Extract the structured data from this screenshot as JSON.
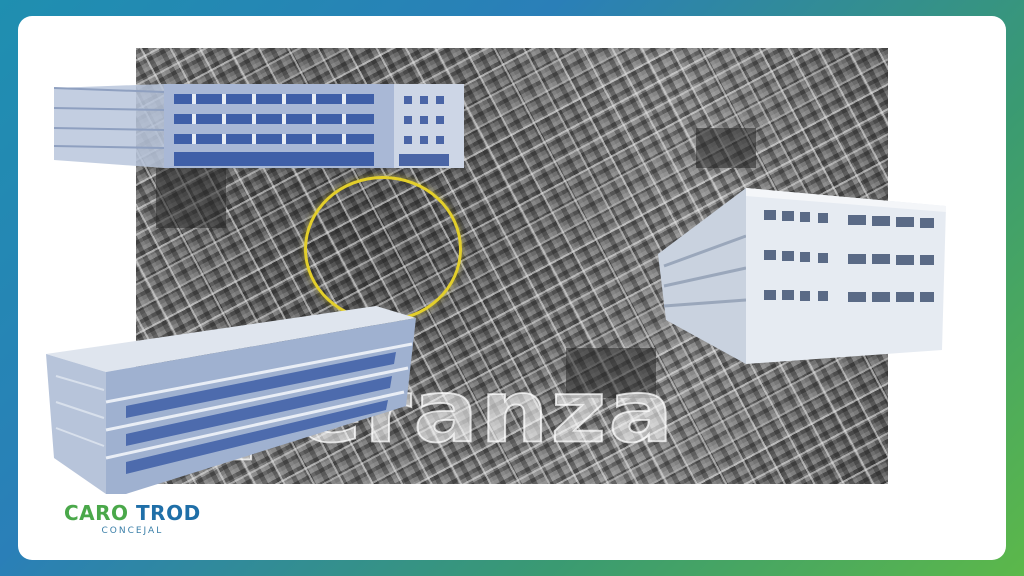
{
  "brand": {
    "name_first": "CARO",
    "name_second": "TROD",
    "subtitle": "CONCEJAL",
    "color_primary": "#4aa84a",
    "color_secondary": "#1f6fa8"
  },
  "watermark": {
    "text": "esperanza"
  },
  "highlight": {
    "color": "#e3cf2b"
  },
  "illustrations": [
    "aerial-city-map",
    "building-render-top-left",
    "building-render-right",
    "building-render-bottom-left"
  ]
}
